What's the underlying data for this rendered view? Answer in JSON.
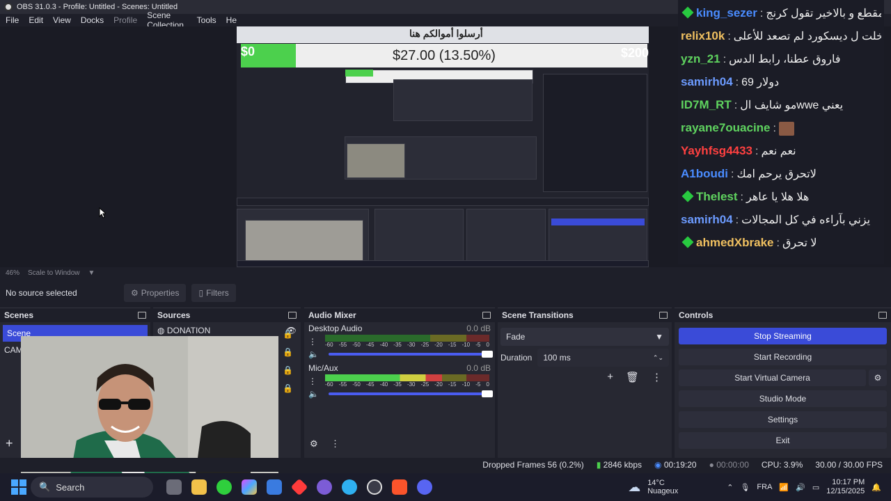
{
  "window": {
    "title": "OBS 31.0.3 - Profile: Untitled - Scenes: Untitled"
  },
  "menu": {
    "items": [
      "File",
      "Edit",
      "View",
      "Docks",
      "Profile",
      "Scene Collection",
      "Tools",
      "He"
    ]
  },
  "overlay": {
    "banner": "أرسلوا أموالكم هنا",
    "goal_text": "$27.00 (13.50%)",
    "goal_progress": 0.135,
    "min_label": "$0",
    "max_label": "$200"
  },
  "chat": {
    "lines": [
      {
        "user": "king_sezer",
        "color": "#4a8cff",
        "badge": true,
        "text": "داعر تعبت على المقطع و بالاخير تقول كرنج"
      },
      {
        "user": "relix10k",
        "color": "#f0c060",
        "badge": false,
        "text": "فاروق انت لما دخلت ل ديسكورد لم تصعد للأعلى"
      },
      {
        "user": "yzn_21",
        "color": "#5fd35f",
        "badge": false,
        "text": "فاروق عطنا، رابط الدس"
      },
      {
        "user": "samirh04",
        "color": "#6c9bff",
        "badge": false,
        "text": "دولار 69"
      },
      {
        "user": "ID7M_RT",
        "color": "#5fd35f",
        "badge": false,
        "text": "يعني wweمو شايف ال"
      },
      {
        "user": "rayane7ouacine",
        "color": "#5fd35f",
        "badge": false,
        "text": "",
        "emoji": true
      },
      {
        "user": "Yayhfsg4433",
        "color": "#ff4040",
        "badge": false,
        "text": "نعم نعم"
      },
      {
        "user": "A1boudi",
        "color": "#4a8cff",
        "badge": false,
        "text": "لاتحرق يرحم امك"
      },
      {
        "user": "Thelest",
        "color": "#5fd35f",
        "badge": true,
        "text": "هلا هلا يا عاهر"
      },
      {
        "user": "samirh04",
        "color": "#6c9bff",
        "badge": false,
        "text": "يزني بآراءه في كل المجالات"
      },
      {
        "user": "ahmedXbrake",
        "color": "#f0c060",
        "badge": true,
        "text": "لا تحرق"
      }
    ]
  },
  "preview": {
    "zoom": "46%",
    "scale_mode": "Scale to Window"
  },
  "source_bar": {
    "status": "No source selected",
    "properties": "Properties",
    "filters": "Filters"
  },
  "scenes": {
    "title": "Scenes",
    "items": [
      "Scene",
      "CAM"
    ],
    "selected": 0
  },
  "sources": {
    "title": "Sources",
    "items": [
      "DONATION"
    ]
  },
  "audio_mixer": {
    "title": "Audio Mixer",
    "ticks": [
      "-60",
      "-55",
      "-50",
      "-45",
      "-40",
      "-35",
      "-30",
      "-25",
      "-20",
      "-15",
      "-10",
      "-5",
      "0"
    ],
    "channels": [
      {
        "name": "Desktop Audio",
        "db": "0.0 dB",
        "level": 0.0
      },
      {
        "name": "Mic/Aux",
        "db": "0.0 dB",
        "level": 0.71
      }
    ]
  },
  "transitions": {
    "title": "Scene Transitions",
    "selected": "Fade",
    "duration_label": "Duration",
    "duration_value": "100 ms"
  },
  "controls": {
    "title": "Controls",
    "buttons": [
      "Stop Streaming",
      "Start Recording",
      "Start Virtual Camera",
      "Studio Mode",
      "Settings",
      "Exit"
    ]
  },
  "status": {
    "dropped": "Dropped Frames 56 (0.2%)",
    "bitrate": "2846 kbps",
    "stream_time": "00:19:20",
    "rec_time": "00:00:00",
    "cpu": "CPU: 3.9%",
    "fps": "30.00 / 30.00 FPS"
  },
  "taskbar": {
    "search": "Search",
    "weather_temp": "14°C",
    "weather_desc": "Nuageux",
    "lang": "FRA",
    "time": "10:17 PM",
    "date": "12/15/2025"
  },
  "colors": {
    "accent": "#3a4bd8",
    "goal_fill": "#4cd04d",
    "meter_green": "#4cd04d"
  }
}
